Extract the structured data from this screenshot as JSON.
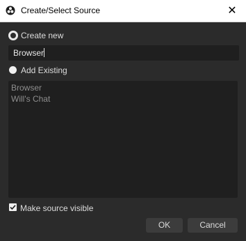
{
  "window": {
    "title": "Create/Select Source",
    "close_glyph": "✕"
  },
  "options": {
    "create_new_label": "Create new",
    "add_existing_label": "Add Existing",
    "selected": "create_new"
  },
  "name_field": {
    "value": "Browser"
  },
  "existing_sources": [
    "Browser",
    "Will's Chat"
  ],
  "visible_checkbox": {
    "label": "Make source visible",
    "checked": true
  },
  "buttons": {
    "ok": "OK",
    "cancel": "Cancel"
  }
}
